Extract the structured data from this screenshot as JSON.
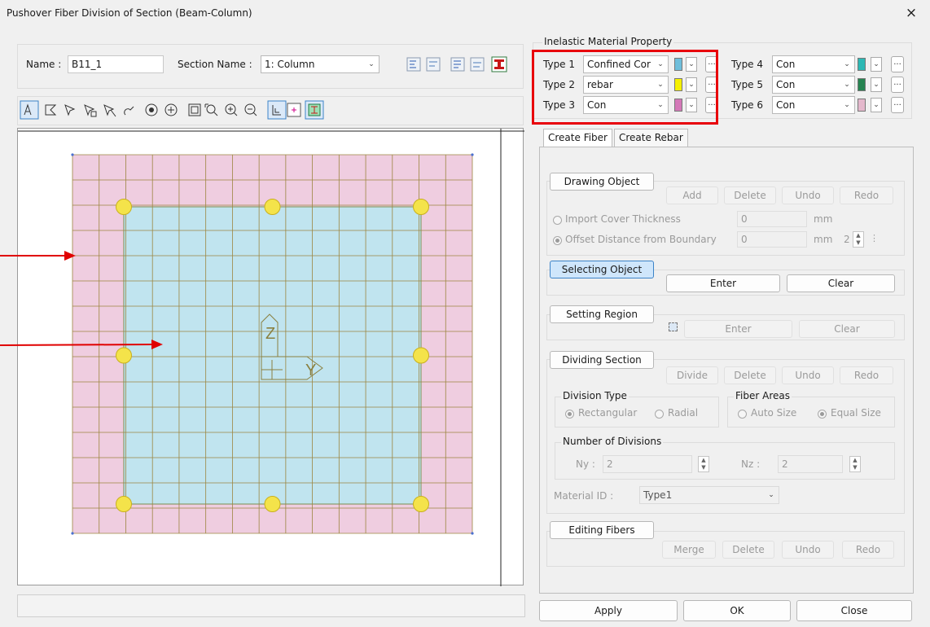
{
  "window": {
    "title": "Pushover Fiber Division of Section (Beam-Column)",
    "close": "×"
  },
  "header": {
    "name_label": "Name :",
    "name_value": "B11_1",
    "section_label": "Section Name :",
    "section_value": "1: Column"
  },
  "inelastic": {
    "group_title": "Inelastic Material Property",
    "types": [
      {
        "label": "Type 1",
        "value": "Confined Cor",
        "color": "#6ebedb"
      },
      {
        "label": "Type 2",
        "value": "rebar",
        "color": "#f5f000"
      },
      {
        "label": "Type 3",
        "value": "Con",
        "color": "#d478b8"
      },
      {
        "label": "Type 4",
        "value": "Con",
        "color": "#2cb8b4"
      },
      {
        "label": "Type 5",
        "value": "Con",
        "color": "#268451"
      },
      {
        "label": "Type 6",
        "value": "Con",
        "color": "#e4b8cc"
      }
    ],
    "more": "..."
  },
  "tabs": {
    "create_fiber": "Create Fiber",
    "create_rebar": "Create Rebar"
  },
  "drawing_object": {
    "title": "Drawing Object",
    "add": "Add",
    "delete": "Delete",
    "undo": "Undo",
    "redo": "Redo",
    "import_cover": "Import Cover Thickness",
    "import_cover_value": "0",
    "offset_distance": "Offset Distance from Boundary",
    "offset_value": "0",
    "unit": "mm",
    "unit2": "mm",
    "offset_count": "2"
  },
  "selecting_object": {
    "title": "Selecting Object",
    "enter": "Enter",
    "clear": "Clear"
  },
  "setting_region": {
    "title": "Setting Region",
    "enter": "Enter",
    "clear": "Clear"
  },
  "dividing_section": {
    "title": "Dividing Section",
    "divide": "Divide",
    "delete": "Delete",
    "undo": "Undo",
    "redo": "Redo",
    "division_type": "Division Type",
    "rectangular": "Rectangular",
    "radial": "Radial",
    "fiber_areas": "Fiber Areas",
    "auto_size": "Auto Size",
    "equal_size": "Equal Size",
    "number_of_divisions": "Number of Divisions",
    "ny_label": "Ny :",
    "ny_value": "2",
    "nz_label": "Nz :",
    "nz_value": "2",
    "material_id_label": "Material ID :",
    "material_id_value": "Type1"
  },
  "editing_fibers": {
    "title": "Editing Fibers",
    "merge": "Merge",
    "delete": "Delete",
    "undo": "Undo",
    "redo": "Redo"
  },
  "footer": {
    "apply": "Apply",
    "ok": "OK",
    "close": "Close"
  },
  "canvas": {
    "axis_z": "Z",
    "axis_y": "Y",
    "cover_color": "#efcde0",
    "core_color": "#c0e4ef",
    "grid_color": "#9c8640",
    "rebar_color": "#f4e34a",
    "annotation_color": "#e00000",
    "grid_divisions": 15,
    "rebar_count": 8
  },
  "colors": {
    "highlight_box": "#e8000b",
    "selected_button": "#cfe6fb"
  }
}
